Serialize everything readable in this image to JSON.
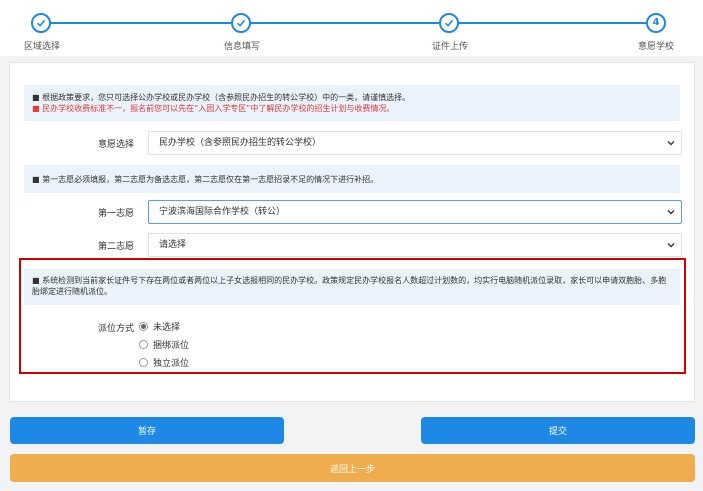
{
  "steps": [
    {
      "label": "区域选择",
      "state": "done"
    },
    {
      "label": "信息填写",
      "state": "done"
    },
    {
      "label": "证件上传",
      "state": "done"
    },
    {
      "label": "意愿学校",
      "state": "current",
      "number": "4"
    }
  ],
  "notice1": {
    "line1": "■ 根据政策要求，您只可选择公办学校或民办学校（含参照民办招生的转公学校）中的一类，请谨慎选择。",
    "line2": "■ 民办学校收费标准不一，报名前您可以先在“入园入学专区”中了解民办学校的招生计划与收费情况。"
  },
  "intention": {
    "label": "意愿选择",
    "value": "民办学校（含参照民办招生的转公学校）"
  },
  "notice2": "■ 第一志愿必须填报，第二志愿为备选志愿，第二志愿仅在第一志愿招录不足的情况下进行补招。",
  "choice1": {
    "label": "第一志愿",
    "value": "宁波滨海国际合作学校（转公）"
  },
  "choice2": {
    "label": "第二志愿",
    "value": "请选择"
  },
  "notice3": "■ 系统检测到当前家长证件号下存在两位或者两位以上子女选报相同的民办学校。政策规定民办学校报名人数超过计划数的，均实行电脑随机派位录取，家长可以申请双胞胎、多胞胎绑定进行随机派位。",
  "placement": {
    "label": "派位方式",
    "options": [
      "未选择",
      "捆绑派位",
      "独立派位"
    ],
    "selected": 0
  },
  "buttons": {
    "save": "暂存",
    "submit": "提交",
    "back": "返回上一步"
  },
  "colors": {
    "primary": "#1e88e5",
    "warning": "#f0ad4e",
    "alert": "#e53935",
    "highlight_border": "#d10000"
  }
}
